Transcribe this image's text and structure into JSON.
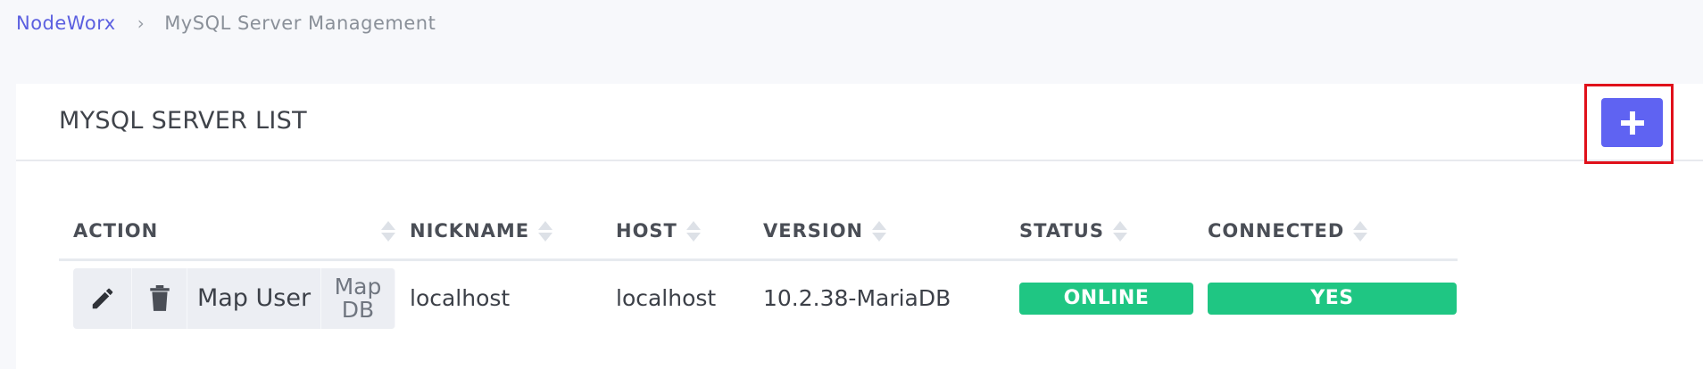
{
  "breadcrumb": {
    "root": "NodeWorx",
    "separator": "›",
    "current": "MySQL Server Management"
  },
  "panel": {
    "title": "MYSQL SERVER LIST",
    "add_button_icon": "plus-icon"
  },
  "table": {
    "columns": [
      "ACTION",
      "NICKNAME",
      "HOST",
      "VERSION",
      "STATUS",
      "CONNECTED"
    ],
    "rows": [
      {
        "actions": {
          "edit_icon": "pencil-icon",
          "delete_icon": "trash-icon",
          "map_user": "Map User",
          "map_db_line1": "Map",
          "map_db_line2": "DB"
        },
        "nickname": "localhost",
        "host": "localhost",
        "version": "10.2.38-MariaDB",
        "status": "ONLINE",
        "connected": "YES"
      }
    ]
  },
  "colors": {
    "accent": "#5f63f2",
    "link": "#5b5fe0",
    "success": "#1fc683",
    "highlight": "#e0101a"
  }
}
